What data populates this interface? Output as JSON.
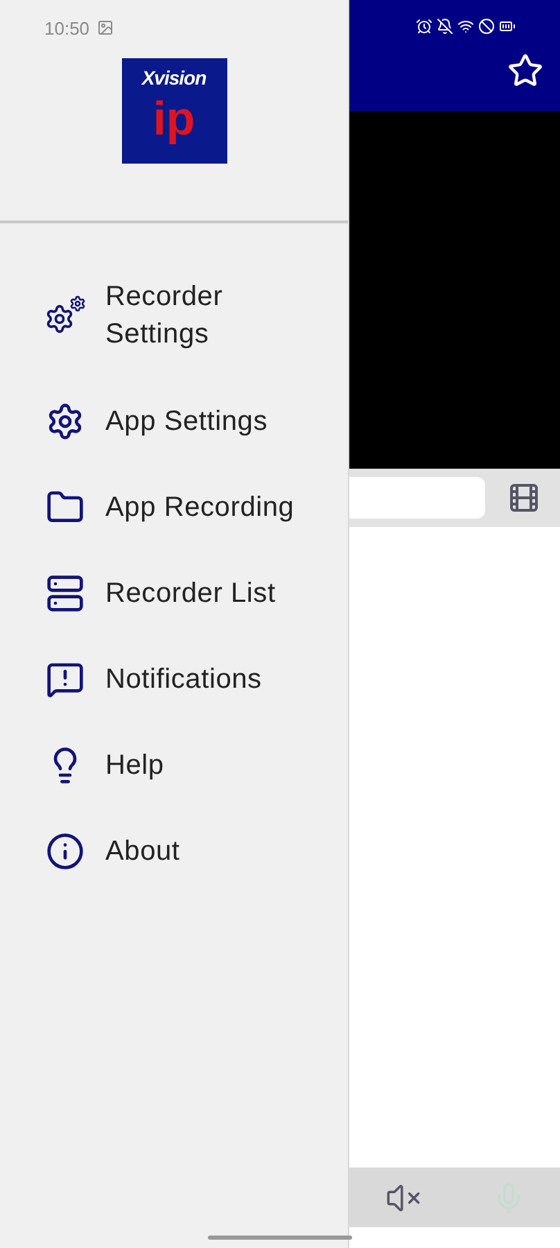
{
  "status_bar": {
    "time": "10:50"
  },
  "logo": {
    "brand": "Xvision",
    "mark": "ip"
  },
  "menu": [
    {
      "label": "Recorder Settings"
    },
    {
      "label": "App Settings"
    },
    {
      "label": "App Recording"
    },
    {
      "label": "Recorder List"
    },
    {
      "label": "Notifications"
    },
    {
      "label": "Help"
    },
    {
      "label": "About"
    }
  ]
}
